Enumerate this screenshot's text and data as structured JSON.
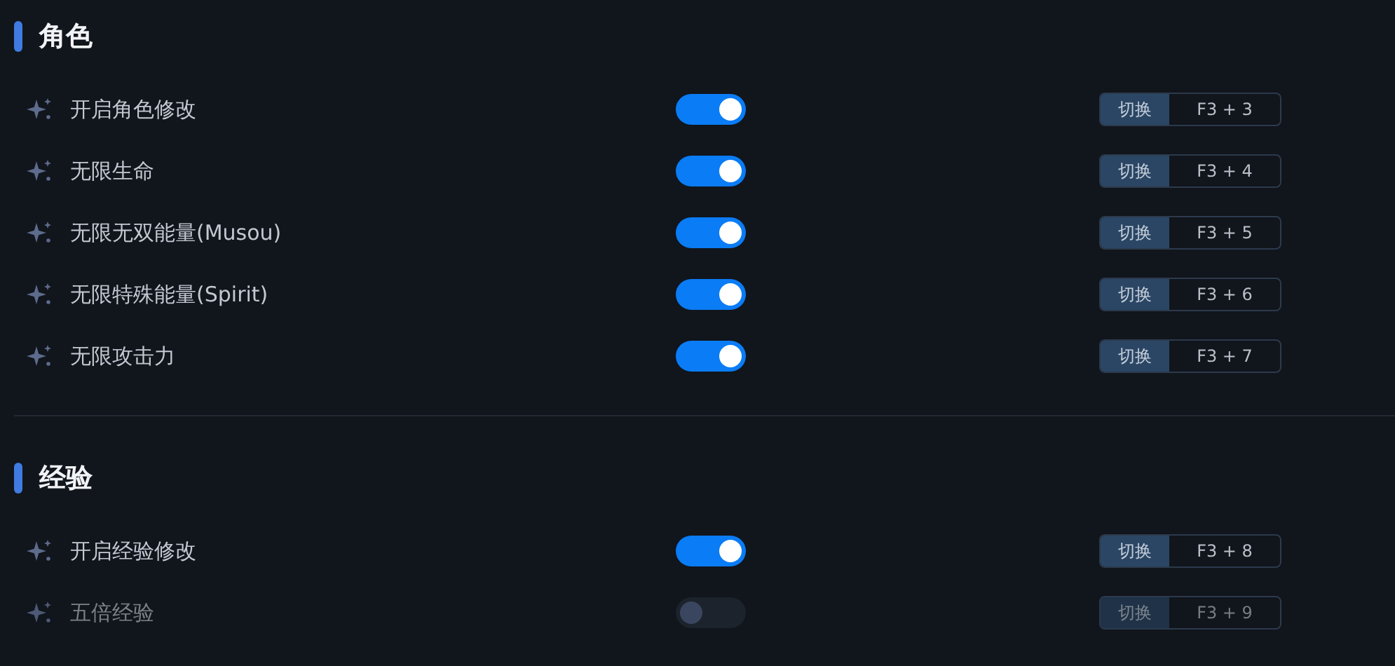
{
  "sections": [
    {
      "title": "角色",
      "items": [
        {
          "label": "开启角色修改",
          "on": true,
          "action": "切换",
          "hotkey": "F3 + 3"
        },
        {
          "label": "无限生命",
          "on": true,
          "action": "切换",
          "hotkey": "F3 + 4"
        },
        {
          "label": "无限无双能量(Musou)",
          "on": true,
          "action": "切换",
          "hotkey": "F3 + 5"
        },
        {
          "label": "无限特殊能量(Spirit)",
          "on": true,
          "action": "切换",
          "hotkey": "F3 + 6"
        },
        {
          "label": "无限攻击力",
          "on": true,
          "action": "切换",
          "hotkey": "F3 + 7"
        }
      ]
    },
    {
      "title": "经验",
      "items": [
        {
          "label": "开启经验修改",
          "on": true,
          "action": "切换",
          "hotkey": "F3 + 8"
        },
        {
          "label": "五倍经验",
          "on": false,
          "action": "切换",
          "hotkey": "F3 + 9"
        }
      ]
    }
  ]
}
